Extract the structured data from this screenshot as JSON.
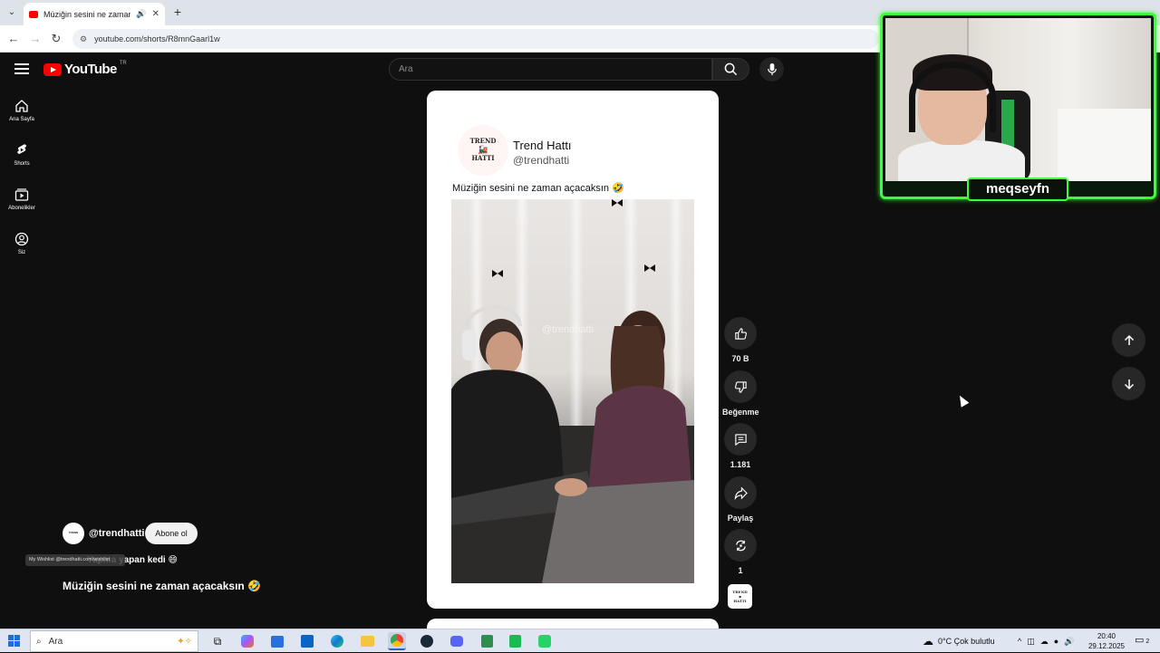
{
  "browser": {
    "tab_title": "Müziğin sesini ne zaman a",
    "url": "youtube.com/shorts/R8mnGaarl1w"
  },
  "youtube": {
    "logo_text": "YouTube",
    "country_code": "TR",
    "search_placeholder": "Ara",
    "guide": [
      {
        "label": "Ana Sayfa",
        "icon": "home-icon"
      },
      {
        "label": "Shorts",
        "icon": "shorts-icon"
      },
      {
        "label": "Abonelikler",
        "icon": "subscriptions-icon"
      },
      {
        "label": "Siz",
        "icon": "you-icon"
      }
    ]
  },
  "short": {
    "card": {
      "avatar_line1": "TREND",
      "avatar_line2": "HATTI",
      "name": "Trend Hattı",
      "handle": "@trendhatti",
      "caption": "Müziğin sesini ne zaman açacaksın 🤣",
      "watermark": "@trendhatti"
    },
    "actions": {
      "like_count": "70 B",
      "dislike_label": "Beğenme",
      "comment_count": "1.181",
      "share_label": "Paylaş",
      "remix_count": "1"
    },
    "overlay": {
      "channel_handle": "@trendhatti",
      "subscribe_label": "Abone ol",
      "wishlist_text": "My Wishlist @trendhatti.com/wishlist",
      "music_text": "Yapma yapan kedi 😄",
      "title": "Müziğin sesini ne zaman açacaksın 🤣"
    }
  },
  "webcam": {
    "name": "meqseyfn",
    "frame_color": "#3cff3c"
  },
  "taskbar": {
    "search_placeholder": "Ara",
    "weather": "0°C  Çok bulutlu",
    "time": "20:40",
    "date": "29.12.2025",
    "notification_count": "2"
  }
}
